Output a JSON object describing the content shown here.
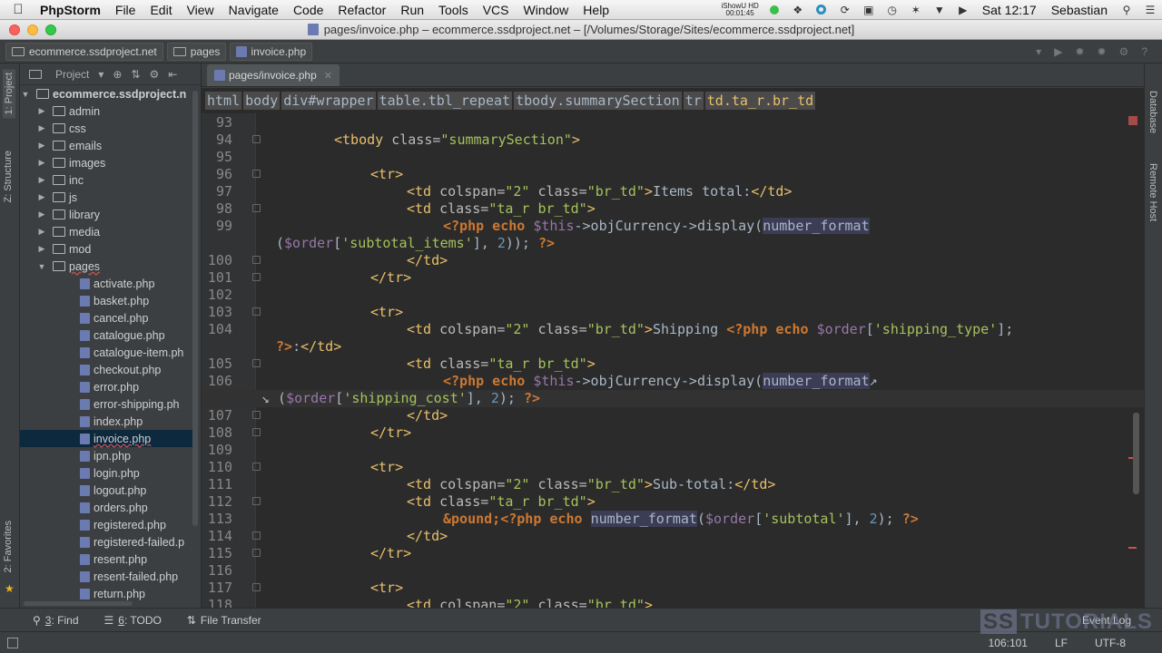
{
  "menubar": {
    "app": "PhpStorm",
    "items": [
      "File",
      "Edit",
      "View",
      "Navigate",
      "Code",
      "Refactor",
      "Run",
      "Tools",
      "VCS",
      "Window",
      "Help"
    ],
    "showu": "iShowU HD",
    "showu_time": "00:01:45",
    "clock": "Sat 12:17",
    "user": "Sebastian"
  },
  "window": {
    "title": "pages/invoice.php – ecommerce.ssdproject.net – [/Volumes/Storage/Sites/ecommerce.ssdproject.net]"
  },
  "navbar": {
    "crumbs": [
      "ecommerce.ssdproject.net",
      "pages",
      "invoice.php"
    ]
  },
  "left_strip": {
    "project": "1: Project",
    "structure": "Z: Structure",
    "favorites": "2: Favorites"
  },
  "project": {
    "header": "Project",
    "root": "ecommerce.ssdproject.n",
    "folders": [
      "admin",
      "css",
      "emails",
      "images",
      "inc",
      "js",
      "library",
      "media",
      "mod",
      "pages"
    ],
    "files": [
      "activate.php",
      "basket.php",
      "cancel.php",
      "catalogue.php",
      "catalogue-item.ph",
      "checkout.php",
      "error.php",
      "error-shipping.ph",
      "index.php",
      "invoice.php",
      "ipn.php",
      "login.php",
      "logout.php",
      "orders.php",
      "registered.php",
      "registered-failed.p",
      "resent.php",
      "resent-failed.php",
      "return.php"
    ]
  },
  "editor": {
    "tab": "pages/invoice.php",
    "breadcrumb": [
      "html",
      "body",
      "div#wrapper",
      "table.tbl_repeat",
      "tbody.summarySection",
      "tr",
      "td.ta_r.br_td"
    ],
    "line_numbers": [
      "93",
      "94",
      "95",
      "96",
      "97",
      "98",
      "99",
      "",
      "100",
      "101",
      "102",
      "103",
      "104",
      "",
      "105",
      "106",
      "",
      "107",
      "108",
      "109",
      "110",
      "111",
      "112",
      "113",
      "114",
      "115",
      "116",
      "117",
      "118"
    ]
  },
  "right_strip": {
    "database": "Database",
    "remote": "Remote Host"
  },
  "bottom_tools": {
    "find_num": "3",
    "find": ": Find",
    "todo_num": "6",
    "todo": ": TODO",
    "transfer": "File Transfer",
    "event_log": "Event Log"
  },
  "status": {
    "position": "106:101",
    "line_sep": "LF",
    "encoding": "UTF-8"
  },
  "watermark": {
    "ss": "SS",
    "text": "TUTORIALS"
  }
}
